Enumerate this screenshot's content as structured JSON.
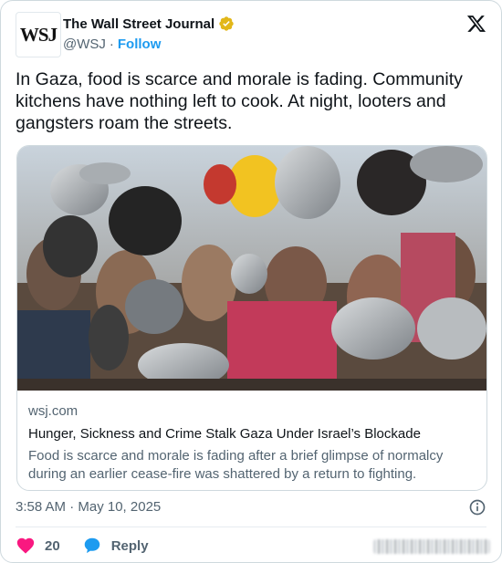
{
  "account": {
    "avatar_text": "WSJ",
    "name": "The Wall Street Journal",
    "handle": "@WSJ",
    "separator": "·",
    "follow_label": "Follow",
    "verified_color": "#e2b719"
  },
  "tweet": {
    "text": "In Gaza, food is scarce and morale is fading. Community kitchens have nothing left to cook. At night, looters and gangsters roam the streets."
  },
  "link_card": {
    "image_icon": "photo-of-people-holding-pots",
    "domain": "wsj.com",
    "headline": "Hunger, Sickness and Crime Stalk Gaza Under Israel’s Blockade",
    "description": "Food is scarce and morale is fading after a brief glimpse of normalcy during an earlier cease-fire was shattered by a return to fighting."
  },
  "meta": {
    "timestamp": "3:58 AM · May 10, 2025",
    "info_icon": "info-icon"
  },
  "actions": {
    "like_count": "20",
    "like_color": "#f91880",
    "reply_label": "Reply",
    "reply_color": "#1d9bf0"
  }
}
